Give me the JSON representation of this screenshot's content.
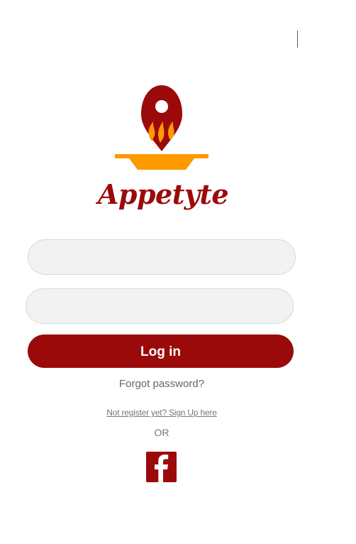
{
  "brand": {
    "name": "Appetyte"
  },
  "login_form": {
    "username_placeholder": "",
    "password_placeholder": "",
    "login_label": "Log in",
    "forgot_password_label": "Forgot password?",
    "signup_link_label": "Not register yet? Sign Up here",
    "divider_label": "OR",
    "facebook_icon": "facebook-icon"
  },
  "colors": {
    "brand_red": "#9b0a0a",
    "flame_orange": "#ff9900",
    "field_bg": "#f2f2f2"
  }
}
